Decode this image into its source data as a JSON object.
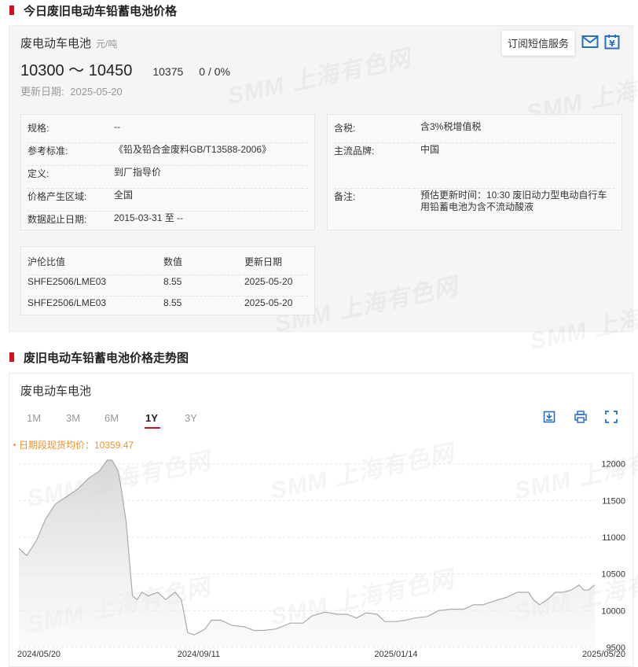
{
  "section1": {
    "title": "今日废旧电动车铅蓄电池价格"
  },
  "product": {
    "name": "废电动车电池",
    "unit": "元/吨",
    "price_range": "10300 ～ 10450",
    "avg": "10375",
    "change": "0 / 0%",
    "update_label": "更新日期:",
    "update_date": "2025-05-20",
    "subscribe_label": "订阅短信服务",
    "icons": [
      "mail-icon",
      "calendar-yuan-icon"
    ]
  },
  "specs_left": [
    {
      "label": "规格:",
      "value": "--"
    },
    {
      "label": "参考标准:",
      "value": "《铅及铅合金废料GB/T13588-2006》"
    },
    {
      "label": "定义:",
      "value": "到厂指导价"
    },
    {
      "label": "价格产生区域:",
      "value": "全国"
    },
    {
      "label": "数据起止日期:",
      "value": "2015-03-31 至 --"
    }
  ],
  "specs_right": [
    {
      "label": "含税:",
      "value": "含3%税增值税"
    },
    {
      "label": "主流品牌:",
      "value": "中国"
    },
    {
      "label": "备注:",
      "value": "预估更新时间：10:30 废旧动力型电动自行车用铅蓄电池为含不流动酸液"
    }
  ],
  "ratio_table": {
    "headers": [
      "沪伦比值",
      "数值",
      "更新日期"
    ],
    "rows": [
      [
        "SHFE2506/LME03",
        "8.55",
        "2025-05-20"
      ],
      [
        "SHFE2506/LME03",
        "8.55",
        "2025-05-20"
      ]
    ]
  },
  "section2": {
    "title": "废旧电动车铅蓄电池价格走势图"
  },
  "chart_panel": {
    "title": "废电动车电池",
    "ranges": [
      "1M",
      "3M",
      "6M",
      "1Y",
      "3Y"
    ],
    "active_range": "1Y",
    "tools": [
      "download-icon",
      "print-icon",
      "fullscreen-icon"
    ],
    "avg_label": "日期段现货均价：10359.47"
  },
  "watermark_text": "SMM 上海有色网",
  "colors": {
    "accent": "#d0111b",
    "avg_label": "#f0922c",
    "line": "#aaaaaa"
  },
  "chart_data": {
    "type": "area",
    "x_ticks": [
      "2024/05/20",
      "2024/09/11",
      "2025/01/14",
      "2025/05/20"
    ],
    "y_ticks": [
      9500,
      10000,
      10500,
      11000,
      11500,
      12000
    ],
    "ylim": [
      9500,
      12050
    ],
    "grid": true,
    "series": [
      {
        "x": [
          "2024-05-20",
          "2024-05-25",
          "2024-05-31",
          "2024-06-06",
          "2024-06-12",
          "2024-06-19",
          "2024-06-26",
          "2024-07-03",
          "2024-07-10",
          "2024-07-15",
          "2024-07-18",
          "2024-07-22",
          "2024-07-24",
          "2024-07-27",
          "2024-07-31",
          "2024-08-03",
          "2024-08-06",
          "2024-08-10",
          "2024-08-16",
          "2024-08-21",
          "2024-08-27",
          "2024-08-31",
          "2024-09-04",
          "2024-09-08",
          "2024-09-11",
          "2024-09-15",
          "2024-09-19",
          "2024-09-25",
          "2024-10-02",
          "2024-10-10",
          "2024-10-16",
          "2024-10-22",
          "2024-10-30",
          "2024-11-08",
          "2024-11-16",
          "2024-11-22",
          "2024-11-30",
          "2024-12-08",
          "2024-12-14",
          "2024-12-20",
          "2024-12-26",
          "2025-01-02",
          "2025-01-07",
          "2025-01-14",
          "2025-01-20",
          "2025-01-26",
          "2025-02-03",
          "2025-02-10",
          "2025-02-18",
          "2025-02-26",
          "2025-03-04",
          "2025-03-10",
          "2025-03-17",
          "2025-03-25",
          "2025-04-01",
          "2025-04-08",
          "2025-04-11",
          "2025-04-15",
          "2025-04-20",
          "2025-04-25",
          "2025-04-30",
          "2025-05-05",
          "2025-05-10",
          "2025-05-13",
          "2025-05-16",
          "2025-05-20"
        ],
        "y": [
          10850,
          10750,
          10950,
          11250,
          11450,
          11550,
          11650,
          11800,
          11900,
          12050,
          12050,
          11900,
          11650,
          11200,
          10200,
          10150,
          10250,
          10200,
          10250,
          10150,
          10250,
          10150,
          9700,
          9670,
          9700,
          9750,
          9870,
          9870,
          9800,
          9780,
          9730,
          9730,
          9750,
          9830,
          9830,
          9930,
          9980,
          9950,
          9950,
          9900,
          9970,
          9950,
          9850,
          9850,
          9870,
          9900,
          9920,
          10000,
          10020,
          10020,
          10080,
          10080,
          10130,
          10180,
          10250,
          10250,
          10150,
          10080,
          10150,
          10250,
          10250,
          10280,
          10350,
          10280,
          10280,
          10350
        ]
      }
    ]
  }
}
